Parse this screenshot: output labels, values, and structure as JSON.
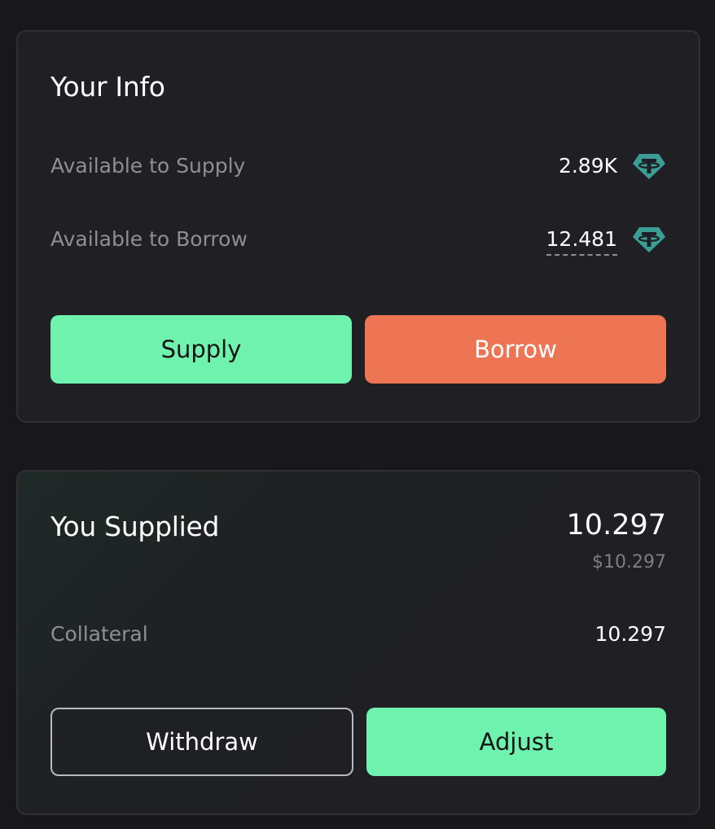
{
  "your_info": {
    "title": "Your Info",
    "available_supply": {
      "label": "Available to Supply",
      "value": "2.89K",
      "icon": "usdt-token-icon"
    },
    "available_borrow": {
      "label": "Available to Borrow",
      "value": "12.481",
      "icon": "usdt-token-icon"
    },
    "supply_button": "Supply",
    "borrow_button": "Borrow"
  },
  "you_supplied": {
    "title": "You Supplied",
    "amount": "10.297",
    "amount_usd": "$10.297",
    "collateral": {
      "label": "Collateral",
      "value": "10.297"
    },
    "withdraw_button": "Withdraw",
    "adjust_button": "Adjust"
  },
  "colors": {
    "accent_green": "#6ff2ae",
    "accent_orange": "#ed7554",
    "token_teal": "#3a9e96"
  }
}
